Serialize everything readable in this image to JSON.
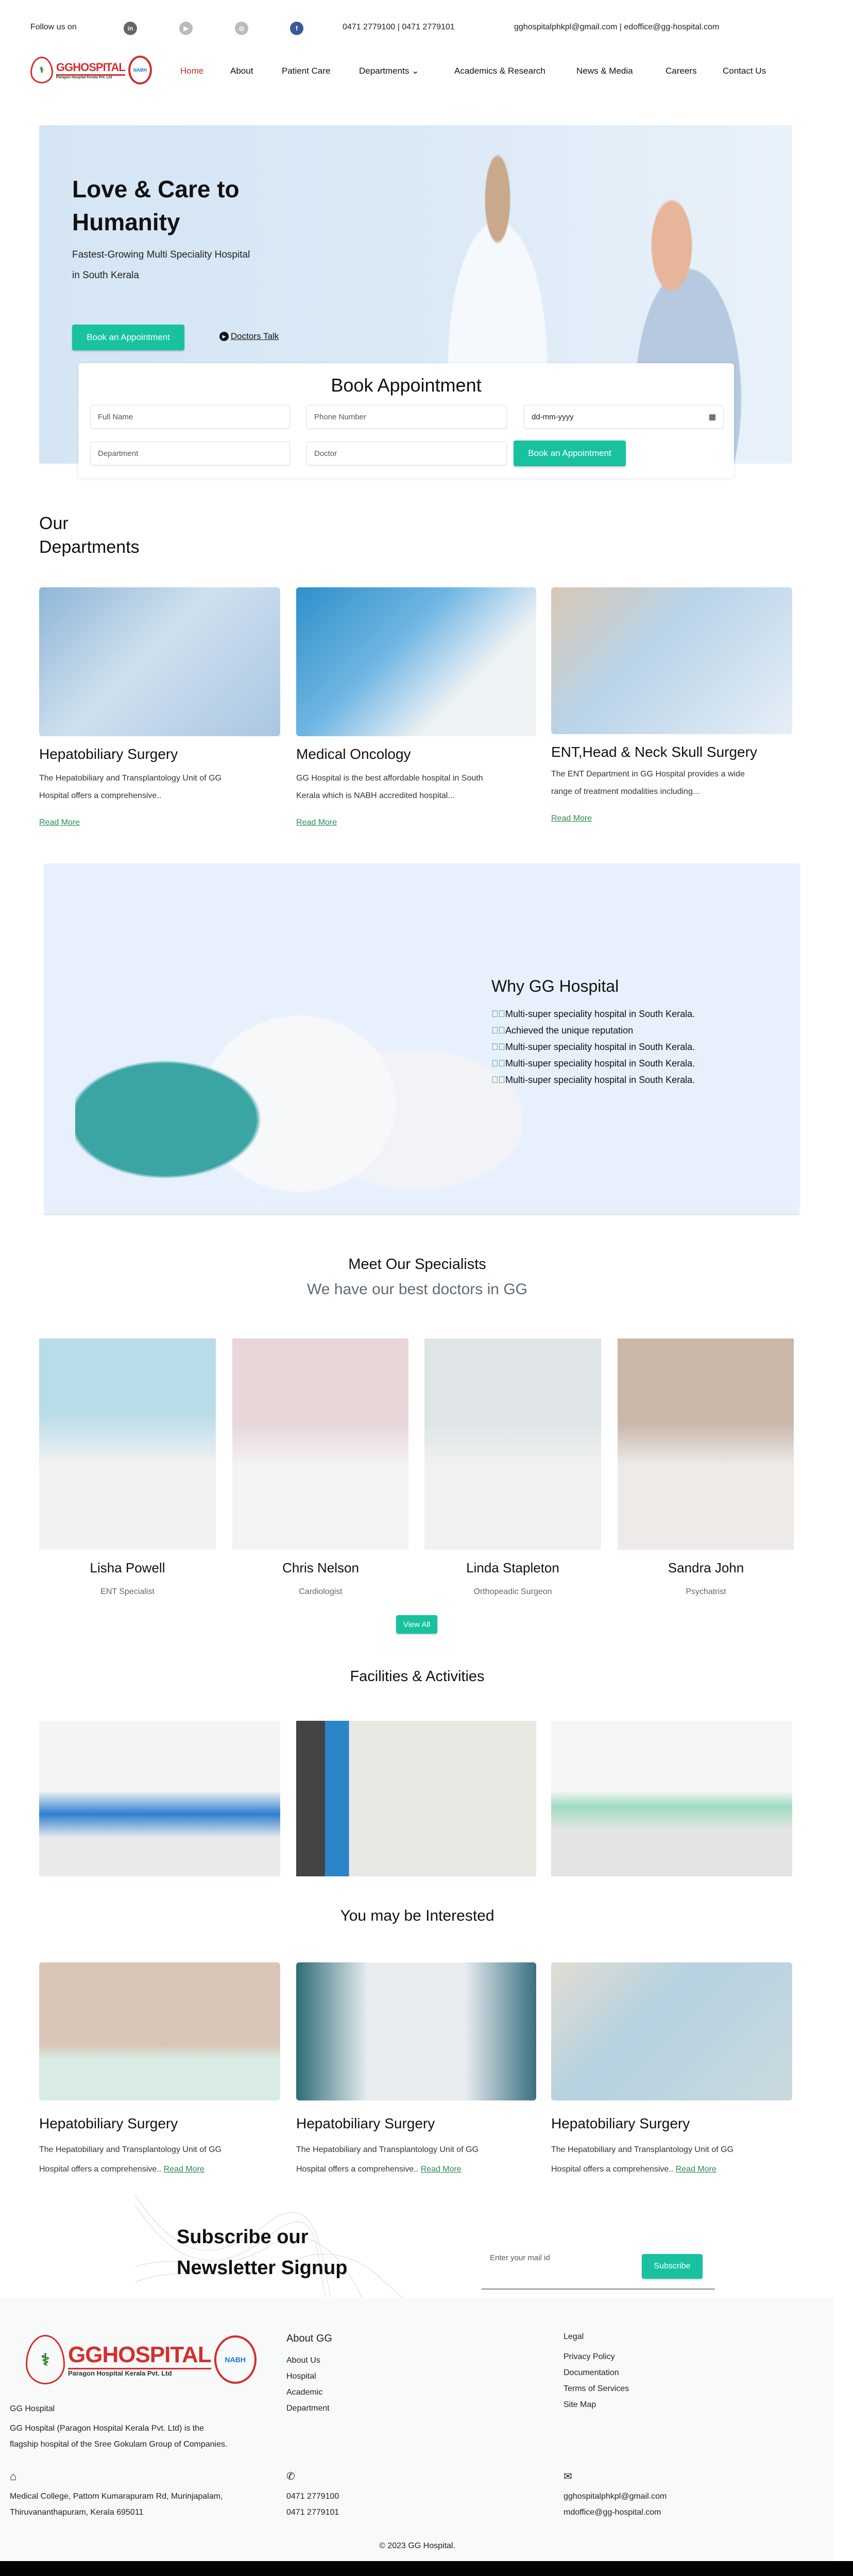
{
  "topbar": {
    "follow_label": "Follow us on",
    "social": [
      {
        "icon": "linkedin-icon",
        "glyph": "in",
        "color": "#666666"
      },
      {
        "icon": "youtube-icon",
        "glyph": "▶",
        "color": "#bbbbbb"
      },
      {
        "icon": "instagram-icon",
        "glyph": "◎",
        "color": "#bbbbbb"
      },
      {
        "icon": "facebook-icon",
        "glyph": "f",
        "color": "#3b5998"
      }
    ],
    "phones": "0471 2779100 | 0471 2779101",
    "emails": "gghospitalphkpl@gmail.com | edoffice@gg-hospital.com"
  },
  "logo": {
    "name": "GGHOSPITAL",
    "company": "Paragon Hospital Kerala Pvt. Ltd",
    "badge": "NABH"
  },
  "nav": {
    "items": [
      "Home",
      "About",
      "Patient Care",
      "Departments",
      "Academics & Research",
      "News & Media",
      "Careers",
      "Contact Us"
    ],
    "active": "Home",
    "active_color": "#c62828"
  },
  "hero": {
    "title_line1": "Love & Care to",
    "title_line2": "Humanity",
    "subtitle_line1": "Fastest-Growing Multi Speciality Hospital",
    "subtitle_line2": "in South Kerala",
    "book_button": "Book an Appointment",
    "doctors_talk": "Doctors Talk"
  },
  "booking": {
    "title": "Book Appointment",
    "full_name_placeholder": "Full Name",
    "phone_placeholder": "Phone Number",
    "date_placeholder": "dd-mm-yyyy",
    "department_placeholder": "Department",
    "doctor_placeholder": "Doctor",
    "submit": "Book an Appointment"
  },
  "departments": {
    "title_line1": "Our",
    "title_line2": "Departments",
    "cards": [
      {
        "title": "Hepatobiliary Surgery",
        "line1": "The Hepatobiliary and Transplantology Unit of GG",
        "line2": "Hospital offers a comprehensive..",
        "link": "Read More"
      },
      {
        "title": "Medical Oncology",
        "line1": "GG Hospital is the best affordable hospital in South",
        "line2": "Kerala which is NABH accredited hospital...",
        "link": "Read More"
      },
      {
        "title": "ENT,Head & Neck Skull Surgery",
        "line1": "The ENT Department in GG Hospital provides a wide",
        "line2": "range of treatment modalities including...",
        "link": "Read More"
      }
    ]
  },
  "why": {
    "title": "Why GG Hospital",
    "points": [
      "Multi-super speciality hospital in South Kerala.",
      "Achieved the unique reputation",
      "Multi-super speciality hospital in South Kerala.",
      "Multi-super speciality hospital in South Kerala.",
      "Multi-super speciality hospital in South Kerala."
    ]
  },
  "specialists": {
    "title": "Meet Our Specialists",
    "subtitle": "We have our best doctors in GG",
    "doctors": [
      {
        "name": "Lisha Powell",
        "role": "ENT Specialist"
      },
      {
        "name": "Chris Nelson",
        "role": "Cardiologist"
      },
      {
        "name": "Linda Stapleton",
        "role": "Orthopeadic Surgeon"
      },
      {
        "name": "Sandra John",
        "role": "Psychatrist"
      }
    ],
    "view_all": "View All"
  },
  "facilities": {
    "title": "Facilities & Activities"
  },
  "interested": {
    "title": "You may be Interested",
    "cards": [
      {
        "title": "Hepatobiliary Surgery",
        "line1": "The Hepatobiliary and Transplantology Unit of GG",
        "line2": "Hospital offers a comprehensive..",
        "link": "Read More"
      },
      {
        "title": "Hepatobiliary Surgery",
        "line1": "The Hepatobiliary and Transplantology Unit of GG",
        "line2": "Hospital offers a comprehensive..",
        "link": "Read More"
      },
      {
        "title": "Hepatobiliary Surgery",
        "line1": "The Hepatobiliary and Transplantology Unit of GG",
        "line2": "Hospital offers a comprehensive..",
        "link": "Read More"
      }
    ]
  },
  "newsletter": {
    "title_line1": "Subscribe our",
    "title_line2": "Newsletter Signup",
    "placeholder": "Enter your mail id",
    "button": "Subscribe"
  },
  "footer": {
    "brand": "GG Hospital",
    "about_line1": "GG Hospital (Paragon Hospital Kerala Pvt. Ltd) is the",
    "about_line2": "flagship hospital of the Sree Gokulam Group of Companies.",
    "about_title": "About GG",
    "about_links": [
      "About Us",
      "Hospital",
      "Academic",
      "Department"
    ],
    "legal_title": "Legal",
    "legal_links": [
      "Privacy Policy",
      "Documentation",
      "Terms of Services",
      "Site Map"
    ],
    "address_line1": "Medical College, Pattom Kumarapuram Rd, Murinjapalam,",
    "address_line2": "Thiruvananthapuram, Kerala 695011",
    "phone1": "0471 2779100",
    "phone2": "0471 2779101",
    "email1": "gghospitalphkpl@gmail.com",
    "email2": "mdoffice@gg-hospital.com",
    "copyright": "© 2023 GG Hospital."
  },
  "colors": {
    "accent": "#19c29e",
    "link": "#2e8b57",
    "brand_red": "#d32f2f"
  }
}
